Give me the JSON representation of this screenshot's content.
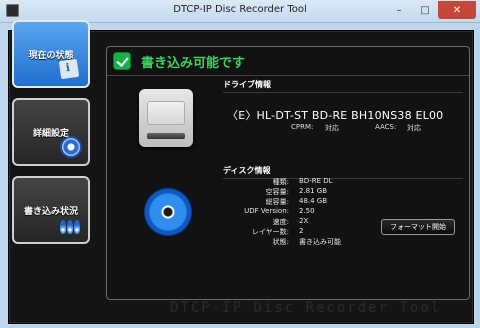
{
  "window": {
    "title": "DTCP-IP Disc Recorder Tool",
    "controls": {
      "minimize": "–",
      "maximize": "□",
      "close": "✕"
    }
  },
  "nav": {
    "status_label": "現在の状態",
    "settings_label": "詳細設定",
    "write_label": "書き込み状況"
  },
  "status": {
    "text": "書き込み可能です"
  },
  "drive": {
    "section_title": "ドライブ情報",
    "name": "〈E〉HL-DT-ST BD-RE  BH10NS38 EL00",
    "cprm_label": "CPRM:",
    "cprm_value": "対応",
    "aacs_label": "AACS:",
    "aacs_value": "対応"
  },
  "disc": {
    "section_title": "ディスク情報",
    "rows": [
      {
        "k": "種類:",
        "v": "BD-RE DL"
      },
      {
        "k": "空容量:",
        "v": "2.81 GB"
      },
      {
        "k": "総容量:",
        "v": "48.4 GB"
      },
      {
        "k": "UDF Version:",
        "v": "2.50"
      },
      {
        "k": "速度:",
        "v": "2X"
      },
      {
        "k": "レイヤー数:",
        "v": "2"
      },
      {
        "k": "状態:",
        "v": "書き込み可能"
      }
    ],
    "format_button": "フォーマット開始"
  },
  "brand": {
    "text": "DTCP-IP Disc Recorder Tool"
  },
  "colors": {
    "status_green": "#31d65d",
    "nav_active_blue": "#1e6fd0"
  }
}
